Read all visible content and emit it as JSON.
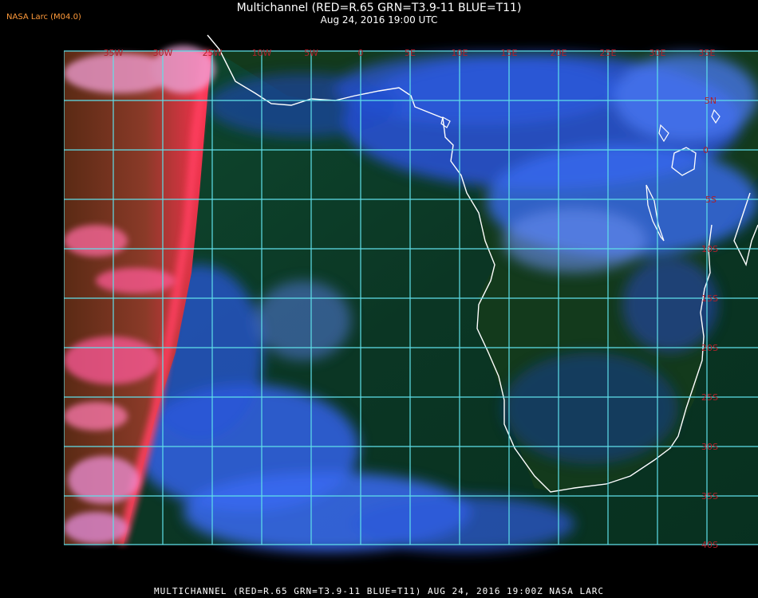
{
  "header": {
    "title": "Multichannel (RED=R.65 GRN=T3.9-11 BLUE=T11)",
    "datetime": "Aug 24, 2016 19:00 UTC",
    "source": "NASA Larc (M04.0)"
  },
  "footer": {
    "caption": "MULTICHANNEL (RED=R.65 GRN=T3.9-11 BLUE=T11) AUG 24, 2016 19:00Z   NASA LARC"
  },
  "map": {
    "longitude_labels": [
      "35W",
      "30W",
      "25W",
      "10W",
      "5W",
      "0",
      "5E",
      "10E",
      "15E",
      "20E",
      "25E",
      "30E",
      "35E"
    ],
    "latitude_labels": [
      "5N",
      "0",
      "5S",
      "10S",
      "15S",
      "20S",
      "25S",
      "30S",
      "35S",
      "40S"
    ],
    "colors": {
      "grid": "#5fe0ea",
      "label": "#b0202a",
      "coastline": "#ffffff",
      "ocean_green": "#0c3a26",
      "cloud_blue": "#2b4fd8",
      "terminator_red": "#ff3a50"
    }
  }
}
